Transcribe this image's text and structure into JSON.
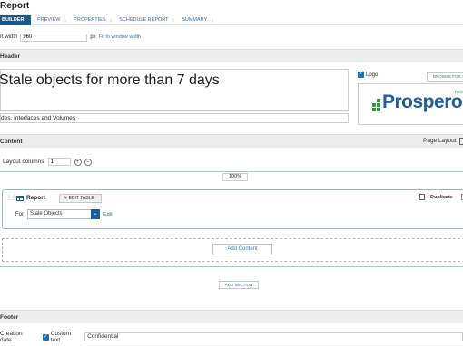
{
  "header": {
    "title": "Report"
  },
  "steps": [
    {
      "label": "BUILDER",
      "active": true
    },
    {
      "label": "PREVIEW",
      "active": false
    },
    {
      "label": "PROPERTIES",
      "active": false
    },
    {
      "label": "SCHEDULE REPORT",
      "active": false
    },
    {
      "label": "SUMMARY",
      "active": false
    }
  ],
  "report_width": {
    "label": "rt width",
    "value": "960",
    "unit": "px",
    "fit_link": "Fit to window width"
  },
  "sections": {
    "header": "Header",
    "content": "Content",
    "footer": "Footer"
  },
  "header_section": {
    "title": "Stale objects for more than 7 days",
    "subtitle": "des, Interfaces and Volumes",
    "logo_label": "Logo",
    "logo_checked": true,
    "browse_button": "BROWSE FOR I",
    "logo_word": "Prospero",
    "logo_tag": "netwo"
  },
  "content_section": {
    "page_layout_label": "Page Layout",
    "layout_columns_label": "Layout columns",
    "layout_columns_value": "1",
    "zoom": "100%",
    "report_panel": {
      "label": "Report",
      "edit_table": "EDIT TABLE",
      "duplicate": "Duplicate",
      "for_label": "For",
      "for_value": "Stale Objects",
      "edit_link": "Edit"
    },
    "add_content": "Add Content",
    "add_section": "ADD SECTION"
  },
  "footer_section": {
    "creation_date_label": "Creation date",
    "custom_text_label": "Custom text",
    "custom_text_checked": true,
    "custom_text_value": "Confidential"
  },
  "colors": {
    "accent": "#1d5a8a",
    "link": "#3b78b5",
    "logo_green": "#2d9a3f"
  }
}
